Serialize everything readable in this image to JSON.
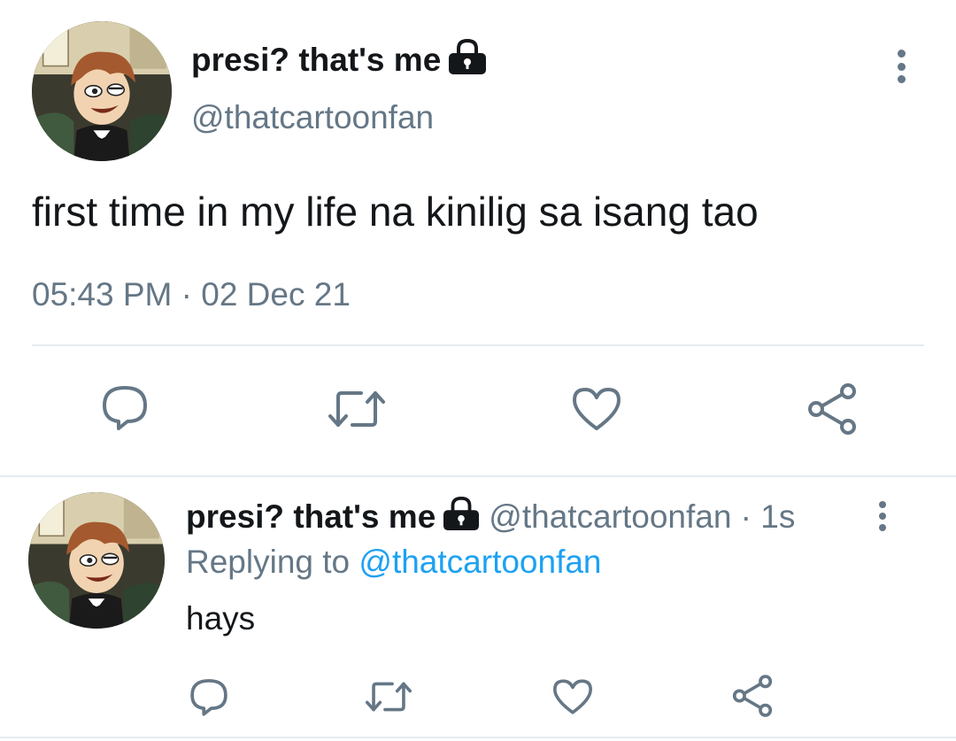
{
  "main_tweet": {
    "display_name": "presi? that's me",
    "handle": "@thatcartoonfan",
    "text": "first time in my life na kinilig sa isang tao",
    "timestamp": "05:43 PM · 02 Dec 21",
    "icons": {
      "avatar": "cartoon-avatar",
      "lock": "lock-icon",
      "menu": "vertical-dots-icon",
      "actions": [
        "reply-icon",
        "retweet-icon",
        "like-icon",
        "share-icon"
      ]
    }
  },
  "reply_tweet": {
    "display_name": "presi? that's me",
    "handle": "@thatcartoonfan",
    "time_ago": "1s",
    "separator": " · ",
    "replying_to_label": "Replying to",
    "replying_to_handle": "@thatcartoonfan",
    "text": "hays"
  },
  "colors": {
    "text": "#14171a",
    "secondary": "#657786",
    "link": "#1da1f2",
    "divider": "#e6ecf0"
  }
}
